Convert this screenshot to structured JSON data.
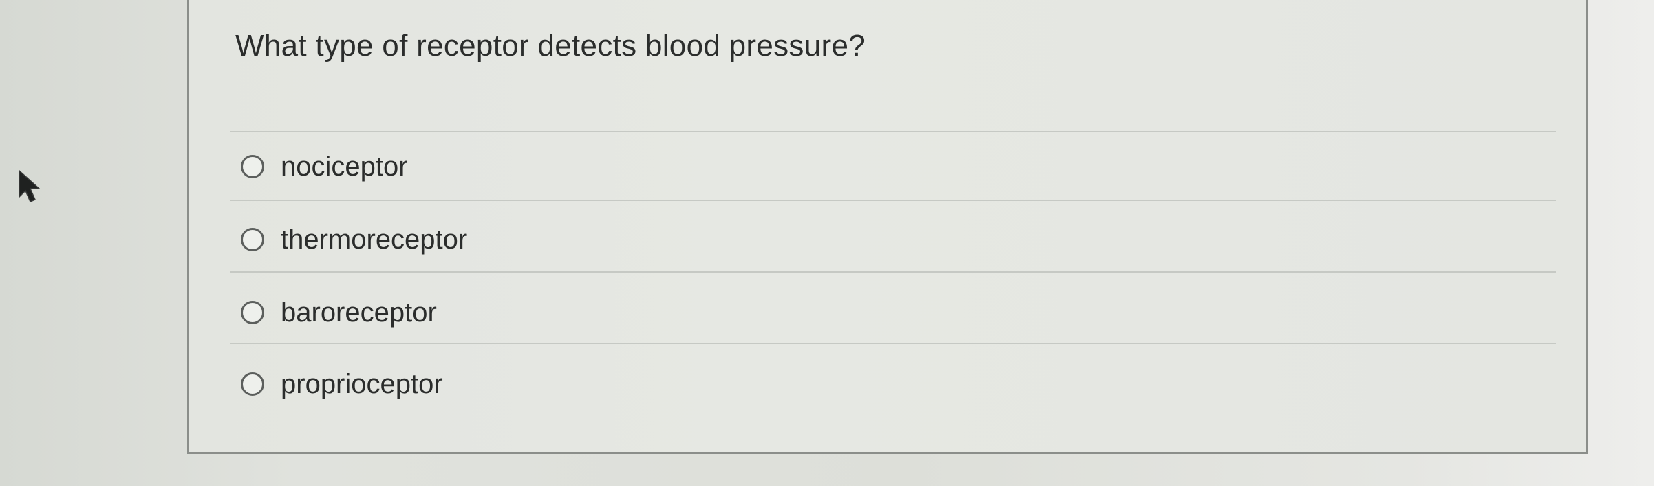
{
  "question": {
    "text": "What type of receptor detects blood pressure?"
  },
  "options": [
    {
      "label": "nociceptor",
      "selected": false
    },
    {
      "label": "thermoreceptor",
      "selected": false
    },
    {
      "label": "baroreceptor",
      "selected": false
    },
    {
      "label": "proprioceptor",
      "selected": false
    }
  ],
  "colors": {
    "background": "#dcdfda",
    "card_border": "#8b8e8a",
    "text": "#2b2d2c",
    "divider": "#c6c9c4"
  }
}
